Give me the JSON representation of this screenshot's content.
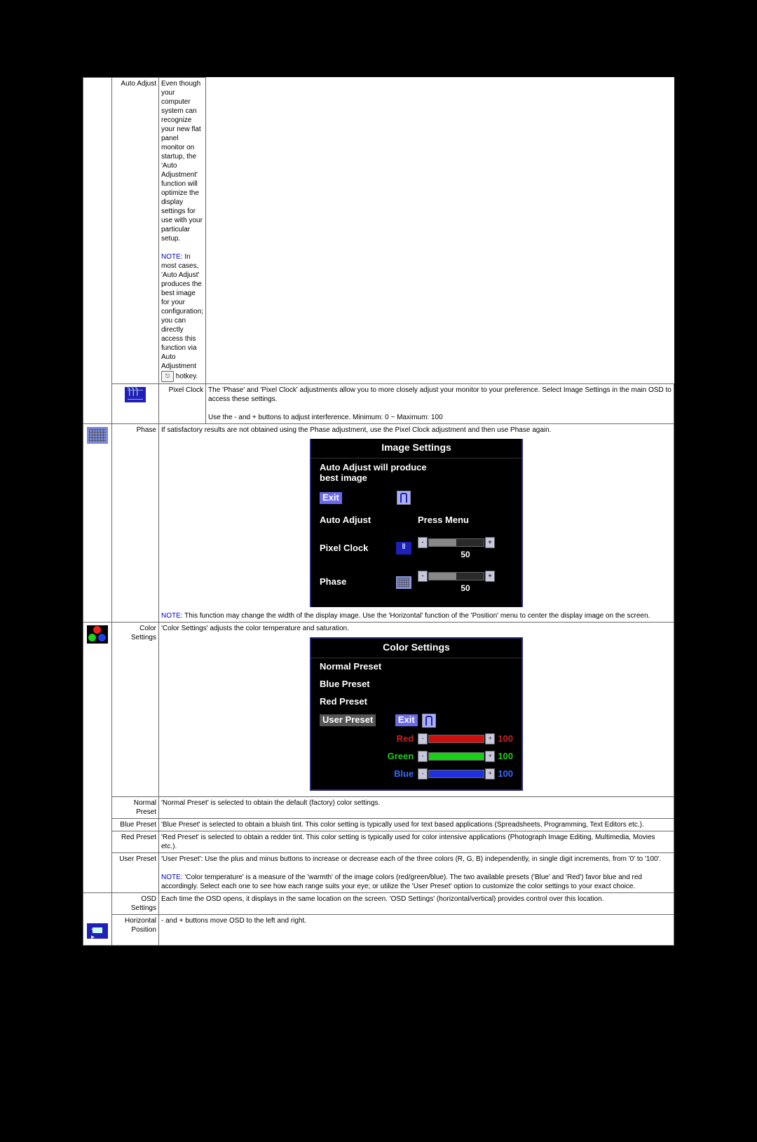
{
  "rows": {
    "auto_adjust": {
      "label": "Auto Adjust",
      "text": "Even though your computer system can recognize your new flat panel monitor on startup, the 'Auto Adjustment' function will optimize the display settings for use with your particular setup.",
      "note": "In most cases, 'Auto Adjust' produces the best image for your configuration; you can directly access this function via Auto Adjustment",
      "note_tail": " hotkey."
    },
    "pixel_clock": {
      "label": "Pixel Clock",
      "text": "The 'Phase' and 'Pixel Clock' adjustments allow you to more closely adjust your monitor to your preference. Select Image Settings in the main OSD to access these settings.",
      "text2": "Use the - and + buttons to adjust interference. Minimum: 0 ~ Maximum: 100"
    },
    "phase": {
      "label": "Phase",
      "text": "If satisfactory results are not obtained using the Phase adjustment, use the Pixel Clock adjustment and then use Phase again.",
      "note": "This function may change the width of the display image.  Use the 'Horizontal' function of the 'Position' menu to center the display image on the screen."
    },
    "color_settings": {
      "label": "Color Settings",
      "text": "'Color Settings' adjusts the color temperature and saturation."
    },
    "normal_preset": {
      "label": "Normal Preset",
      "text": "'Normal Preset' is selected to obtain the default (factory) color settings."
    },
    "blue_preset": {
      "label": "Blue Preset",
      "text": "'Blue Preset' is selected to obtain a bluish tint. This color setting is typically used for text based applications (Spreadsheets, Programming, Text Editors etc.)."
    },
    "red_preset": {
      "label": "Red Preset",
      "text": "'Red Preset' is selected to obtain a redder tint. This color setting is typically used for color intensive applications (Photograph Image Editing, Multimedia, Movies etc.)."
    },
    "user_preset": {
      "label": "User Preset",
      "text": "'User Preset': Use the plus and minus buttons to increase or decrease each of the three colors (R, G, B) independently, in single digit increments, from '0' to '100'.",
      "note": "'Color temperature' is a measure of the 'warmth' of the image colors (red/green/blue). The two available presets ('Blue' and 'Red') favor blue and red accordingly. Select each one to see how each range suits your eye; or utilize the 'User Preset' option to customize the color settings to your exact choice."
    },
    "osd_settings": {
      "label": "OSD Settings",
      "text": "Each time the OSD opens, it displays in the same location on the screen. 'OSD Settings' (horizontal/vertical) provides control over this location."
    },
    "horizontal_position": {
      "label": "Horizontal Position",
      "text": "- and + buttons move OSD to the left and right."
    }
  },
  "note_label": "NOTE:",
  "osd1": {
    "title": "Image Settings",
    "subtitle1": "Auto Adjust will produce",
    "subtitle2": "best image",
    "exit": "Exit",
    "auto_adjust": "Auto Adjust",
    "press_menu": "Press Menu",
    "pixel_clock": "Pixel Clock",
    "phase": "Phase",
    "pixel_clock_val": "50",
    "phase_val": "50"
  },
  "osd2": {
    "title": "Color Settings",
    "items": [
      "Normal Preset",
      "Blue Preset",
      "Red Preset"
    ],
    "user_preset": "User Preset",
    "exit": "Exit",
    "red": "Red",
    "green": "Green",
    "blue": "Blue",
    "red_val": "100",
    "green_val": "100",
    "blue_val": "100"
  }
}
